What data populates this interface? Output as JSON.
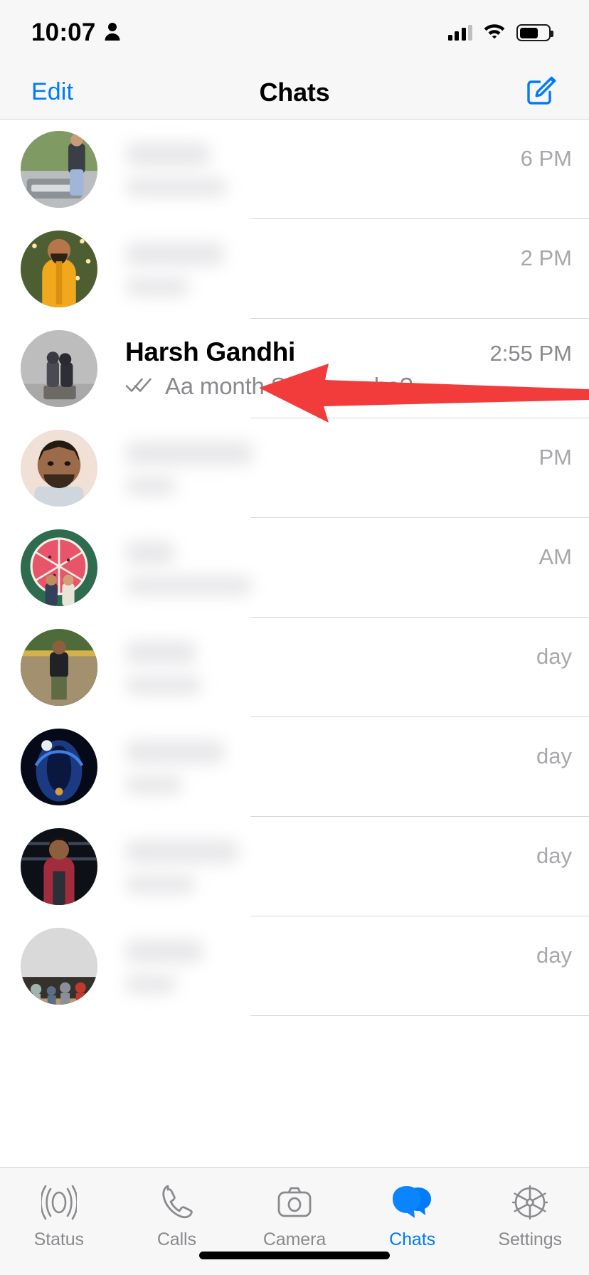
{
  "status_bar": {
    "time": "10:07",
    "person_icon": "person-icon",
    "signal_icon": "cellular-signal-icon",
    "signal_bars_filled": 3,
    "signal_bars_total": 4,
    "wifi_icon": "wifi-icon",
    "battery_icon": "battery-icon",
    "battery_percent": 65
  },
  "nav_bar": {
    "edit_label": "Edit",
    "title": "Chats",
    "compose_icon": "compose-icon",
    "accent_color": "#007aff"
  },
  "chats": [
    {
      "name": "",
      "message": "",
      "time": "6 PM",
      "blurred": true,
      "ticks": false,
      "avatar": "man-beside-audi-car"
    },
    {
      "name": "",
      "message": "",
      "time": "2 PM",
      "blurred": true,
      "ticks": false,
      "avatar": "man-in-yellow-kurta"
    },
    {
      "name": "Harsh Gandhi",
      "message": "Aa month Su Levu che?",
      "time": "2:55 PM",
      "blurred": false,
      "ticks": true,
      "avatar": "couple-on-bench-grey"
    },
    {
      "name": "",
      "message": "",
      "time": "PM",
      "blurred": true,
      "ticks": false,
      "avatar": "man-portrait-beige"
    },
    {
      "name": "",
      "message": "",
      "time": "AM",
      "blurred": true,
      "ticks": false,
      "avatar": "couple-watermelon-mural"
    },
    {
      "name": "",
      "message": "",
      "time": "day",
      "blurred": true,
      "ticks": false,
      "avatar": "boy-standing-outdoor"
    },
    {
      "name": "",
      "message": "",
      "time": "day",
      "blurred": true,
      "ticks": false,
      "avatar": "blue-neon-figure"
    },
    {
      "name": "",
      "message": "",
      "time": "day",
      "blurred": true,
      "ticks": false,
      "avatar": "man-in-red-shirt"
    },
    {
      "name": "",
      "message": "",
      "time": "day",
      "blurred": true,
      "ticks": false,
      "avatar": "group-seated-wall"
    }
  ],
  "annotation": {
    "arrow_icon": "red-left-arrow-annotation",
    "color": "#f23b3b",
    "points_to": "Harsh Gandhi"
  },
  "tab_bar": {
    "active": "Chats",
    "items": [
      {
        "label": "Status",
        "icon": "status-rings-icon"
      },
      {
        "label": "Calls",
        "icon": "phone-icon"
      },
      {
        "label": "Camera",
        "icon": "camera-icon"
      },
      {
        "label": "Chats",
        "icon": "chat-bubbles-icon"
      },
      {
        "label": "Settings",
        "icon": "gear-icon"
      }
    ]
  },
  "home_indicator": "home-indicator-bar"
}
